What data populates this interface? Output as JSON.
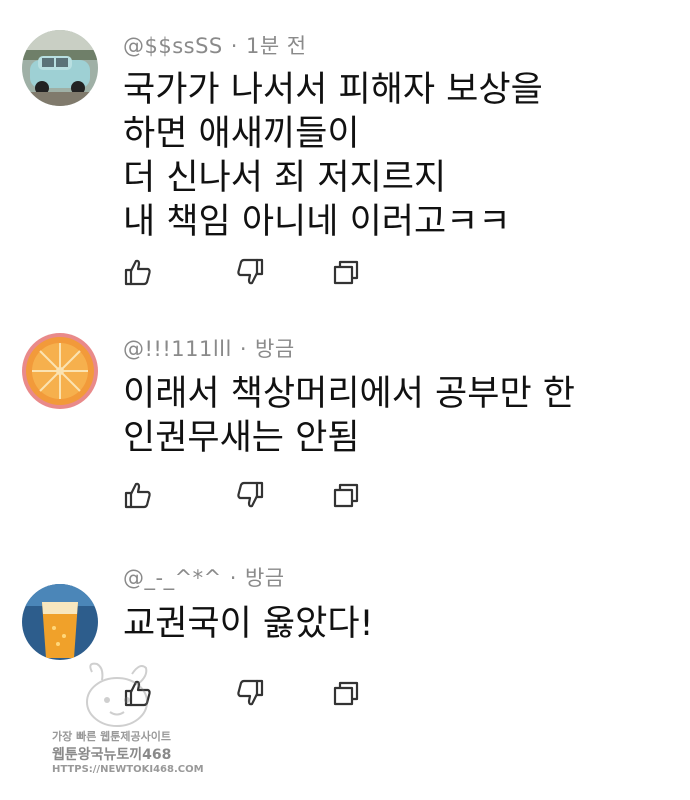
{
  "comments": [
    {
      "author": "@$$ssSS",
      "separator": "·",
      "time": "1분 전",
      "lines": [
        "국가가 나서서 피해자 보상을",
        "하면 애새끼들이",
        "더 신나서 죄 저지르지",
        "내 책임 아니네 이러고ㅋㅋ"
      ],
      "avatar": "car-photo"
    },
    {
      "author": "@!!!111lll",
      "separator": "·",
      "time": "방금",
      "lines": [
        "이래서 책상머리에서 공부만 한",
        "인권무새는 안됨"
      ],
      "avatar": "orange-slice-photo"
    },
    {
      "author": "@_-_^*^",
      "separator": "·",
      "time": "방금",
      "lines": [
        "교권국이 옳았다!"
      ],
      "avatar": "beer-glass-photo"
    }
  ],
  "icons": {
    "like": "thumbs-up-icon",
    "dislike": "thumbs-down-icon",
    "reply": "reply-icon"
  },
  "watermark": {
    "line1": "가장 빠른 웹툰제공사이트",
    "line2": "웹툰왕국뉴토끼468",
    "line3": "HTTPS://NEWTOKI468.COM"
  },
  "colors": {
    "meta": "#8a8a8a",
    "text": "#111111",
    "icon": "#333333"
  }
}
